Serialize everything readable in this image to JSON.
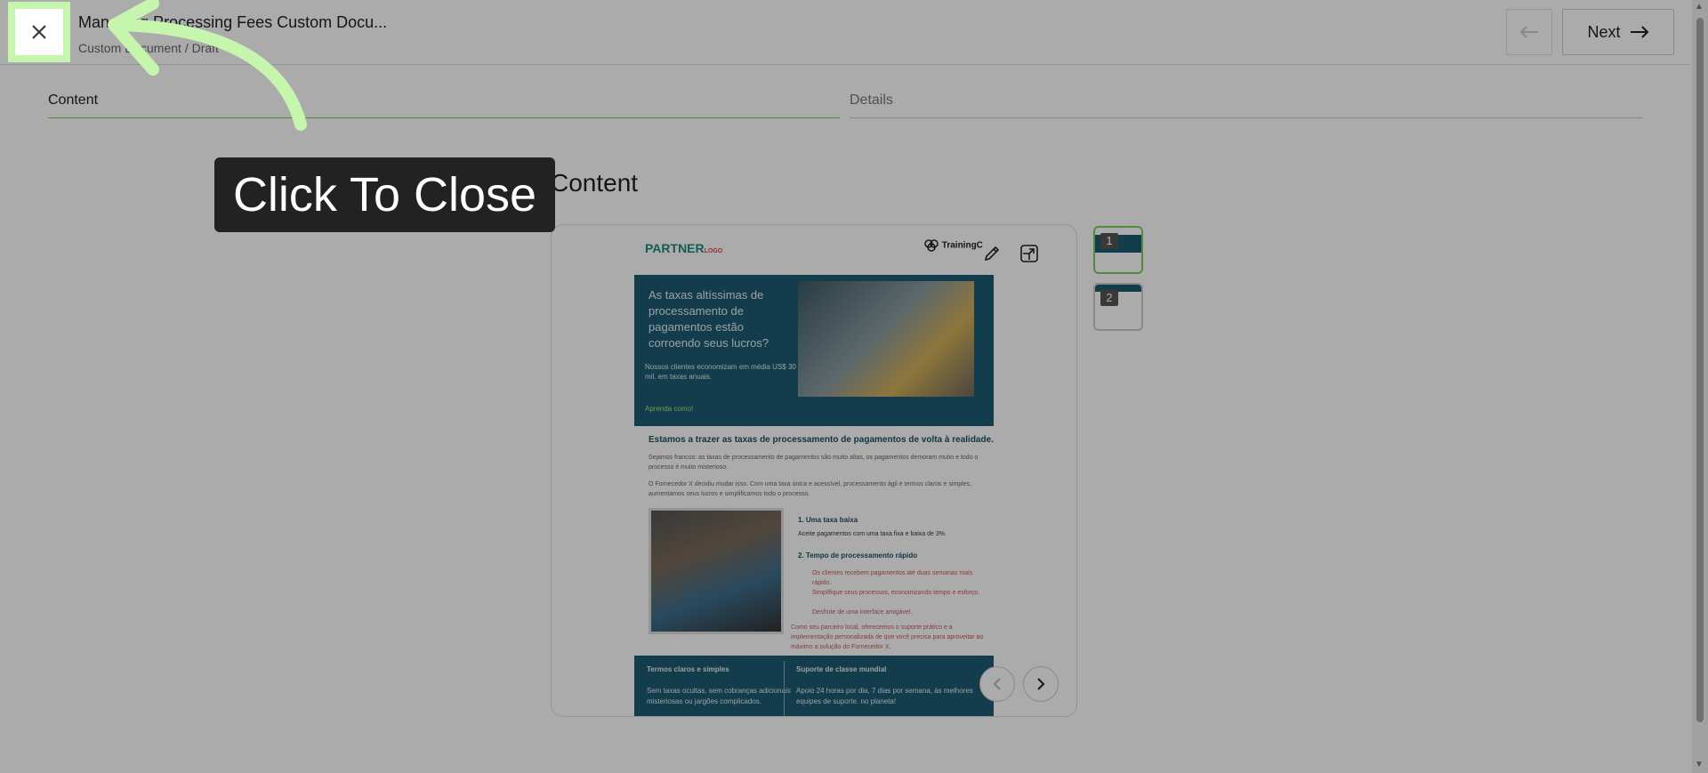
{
  "header": {
    "title": "Managing Processing Fees Custom Docu...",
    "breadcrumb": "Custom Document / Draft",
    "next_label": "Next"
  },
  "tabs": [
    {
      "label": "Content",
      "active": true
    },
    {
      "label": "Details",
      "active": false
    }
  ],
  "section": {
    "title": "Content"
  },
  "document": {
    "logo_text": "PARTNER",
    "logo_sub": "LOGO",
    "brand": "TrainingC",
    "hero_heading": "As taxas altíssimas de processamento de pagamentos estão corroendo seus lucros?",
    "hero_sub": "Nossos clientes economizam em média US$ 30 mil. em taxas anuais.",
    "hero_link": "Aprenda como!",
    "heading2": "Estamos a trazer as taxas de processamento de pagamentos de volta à realidade.",
    "para1": "Sejamos francos: as taxas de processamento de pagamentos são muito altas, os pagamentos demoram muito e todo o processo é muito misterioso.",
    "para2": "O Fornecedor X decidiu mudar isso. Com uma taxa única e acessível, processamento ágil e termos claros e simples, aumentamos seus lucros e simplificamos todo o processo.",
    "feature1_title": "1. Uma taxa baixa",
    "feature1_text": "Aceite pagamentos com uma taxa fixa e baixa de 3%.",
    "feature2_title": "2. Tempo de processamento rápido",
    "feature2_bullets": [
      "Os clientes recebem pagamentos até duas semanas mais rápido.",
      "Simplifique seus processos, economizando tempo e esforço.",
      "Desfrute de uma interface amigável."
    ],
    "feature_note": "Como seu parceiro local, oferecemos o suporte prático e a implementação personalizada de que você precisa para aproveitar ao máximo a solução do Fornecedor X.",
    "bottom_left_title": "Termos claros e simples",
    "bottom_left_text": "Sem taxas ocultas, sem cobranças adicionais misteriosas ou jargões complicados.",
    "bottom_right_title": "Suporte de classe mundial",
    "bottom_right_text": "Apoio 24 horas por dia, 7 dias por semana, às melhores equipes de suporte. no planeta!"
  },
  "thumbnails": [
    {
      "number": "1",
      "selected": true
    },
    {
      "number": "2",
      "selected": false
    }
  ],
  "callout": {
    "text": "Click To Close"
  },
  "colors": {
    "accent": "#7bd05d",
    "highlight": "#c6f5ad",
    "doc_teal": "#1d5a73"
  }
}
